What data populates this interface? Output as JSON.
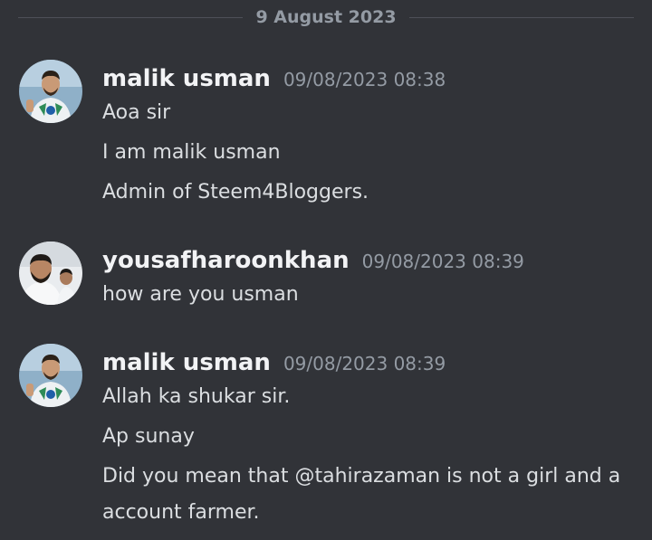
{
  "divider": {
    "date": "9 August 2023"
  },
  "messages": [
    {
      "author": "malik usman",
      "timestamp": "09/08/2023 08:38",
      "lines": [
        "Aoa sir",
        "I am malik usman",
        "Admin of Steem4Bloggers."
      ]
    },
    {
      "author": "yousafharoonkhan",
      "timestamp": "09/08/2023 08:39",
      "lines": [
        "how are you usman"
      ]
    },
    {
      "author": "malik usman",
      "timestamp": "09/08/2023 08:39",
      "lines": [
        "Allah ka shukar sir.",
        "Ap sunay",
        "Did you mean that @tahirazaman is not a girl and a account farmer."
      ]
    }
  ],
  "colors": {
    "background": "#313338",
    "username": "#f2f3f5",
    "timestamp": "#949ba4",
    "message_text": "#dbdee1",
    "divider_line": "#4e5058"
  }
}
